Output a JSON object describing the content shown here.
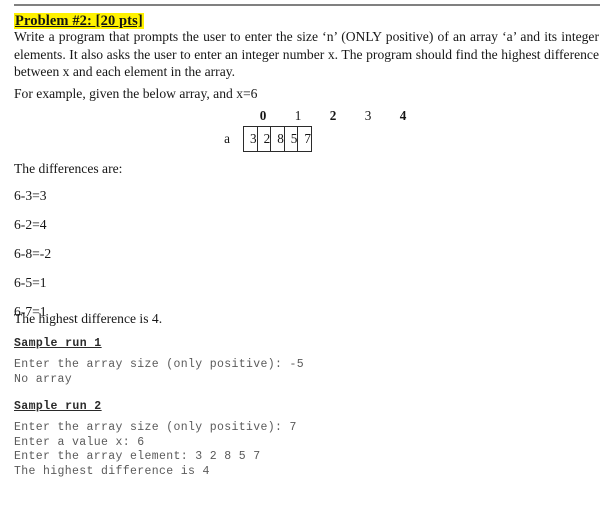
{
  "document": {
    "title": "Problem #2: [20 pts]",
    "title_highlight_color": "#fff200",
    "rule_color": "#808080",
    "description": "Write a program that prompts the user to enter the size ‘n’ (ONLY positive) of an array ‘a’ and its integer elements. It also asks the user to enter an integer number x. The program should find the highest difference between x and each element in the array.",
    "example_intro": "For example, given the below array, and x=6"
  },
  "array_figure": {
    "label": "a",
    "indices": [
      "0",
      "1",
      "2",
      "3",
      "4"
    ],
    "indices_bold": [
      true,
      false,
      true,
      false,
      true
    ],
    "values": [
      "3",
      "2",
      "8",
      "5",
      "7"
    ]
  },
  "differences": {
    "intro": "The differences are:",
    "items": [
      "6-3=3",
      "6-2=4",
      "6-8=-2",
      "6-5=1",
      "6-7=1"
    ],
    "summary": "The highest difference is 4."
  },
  "sample_runs": [
    {
      "heading": "Sample run 1",
      "output": "Enter the array size (only positive): -5\nNo array"
    },
    {
      "heading": "Sample run 2",
      "output": "Enter the array size (only positive): 7\nEnter a value x: 6\nEnter the array element: 3 2 8 5 7\nThe highest difference is 4"
    }
  ]
}
